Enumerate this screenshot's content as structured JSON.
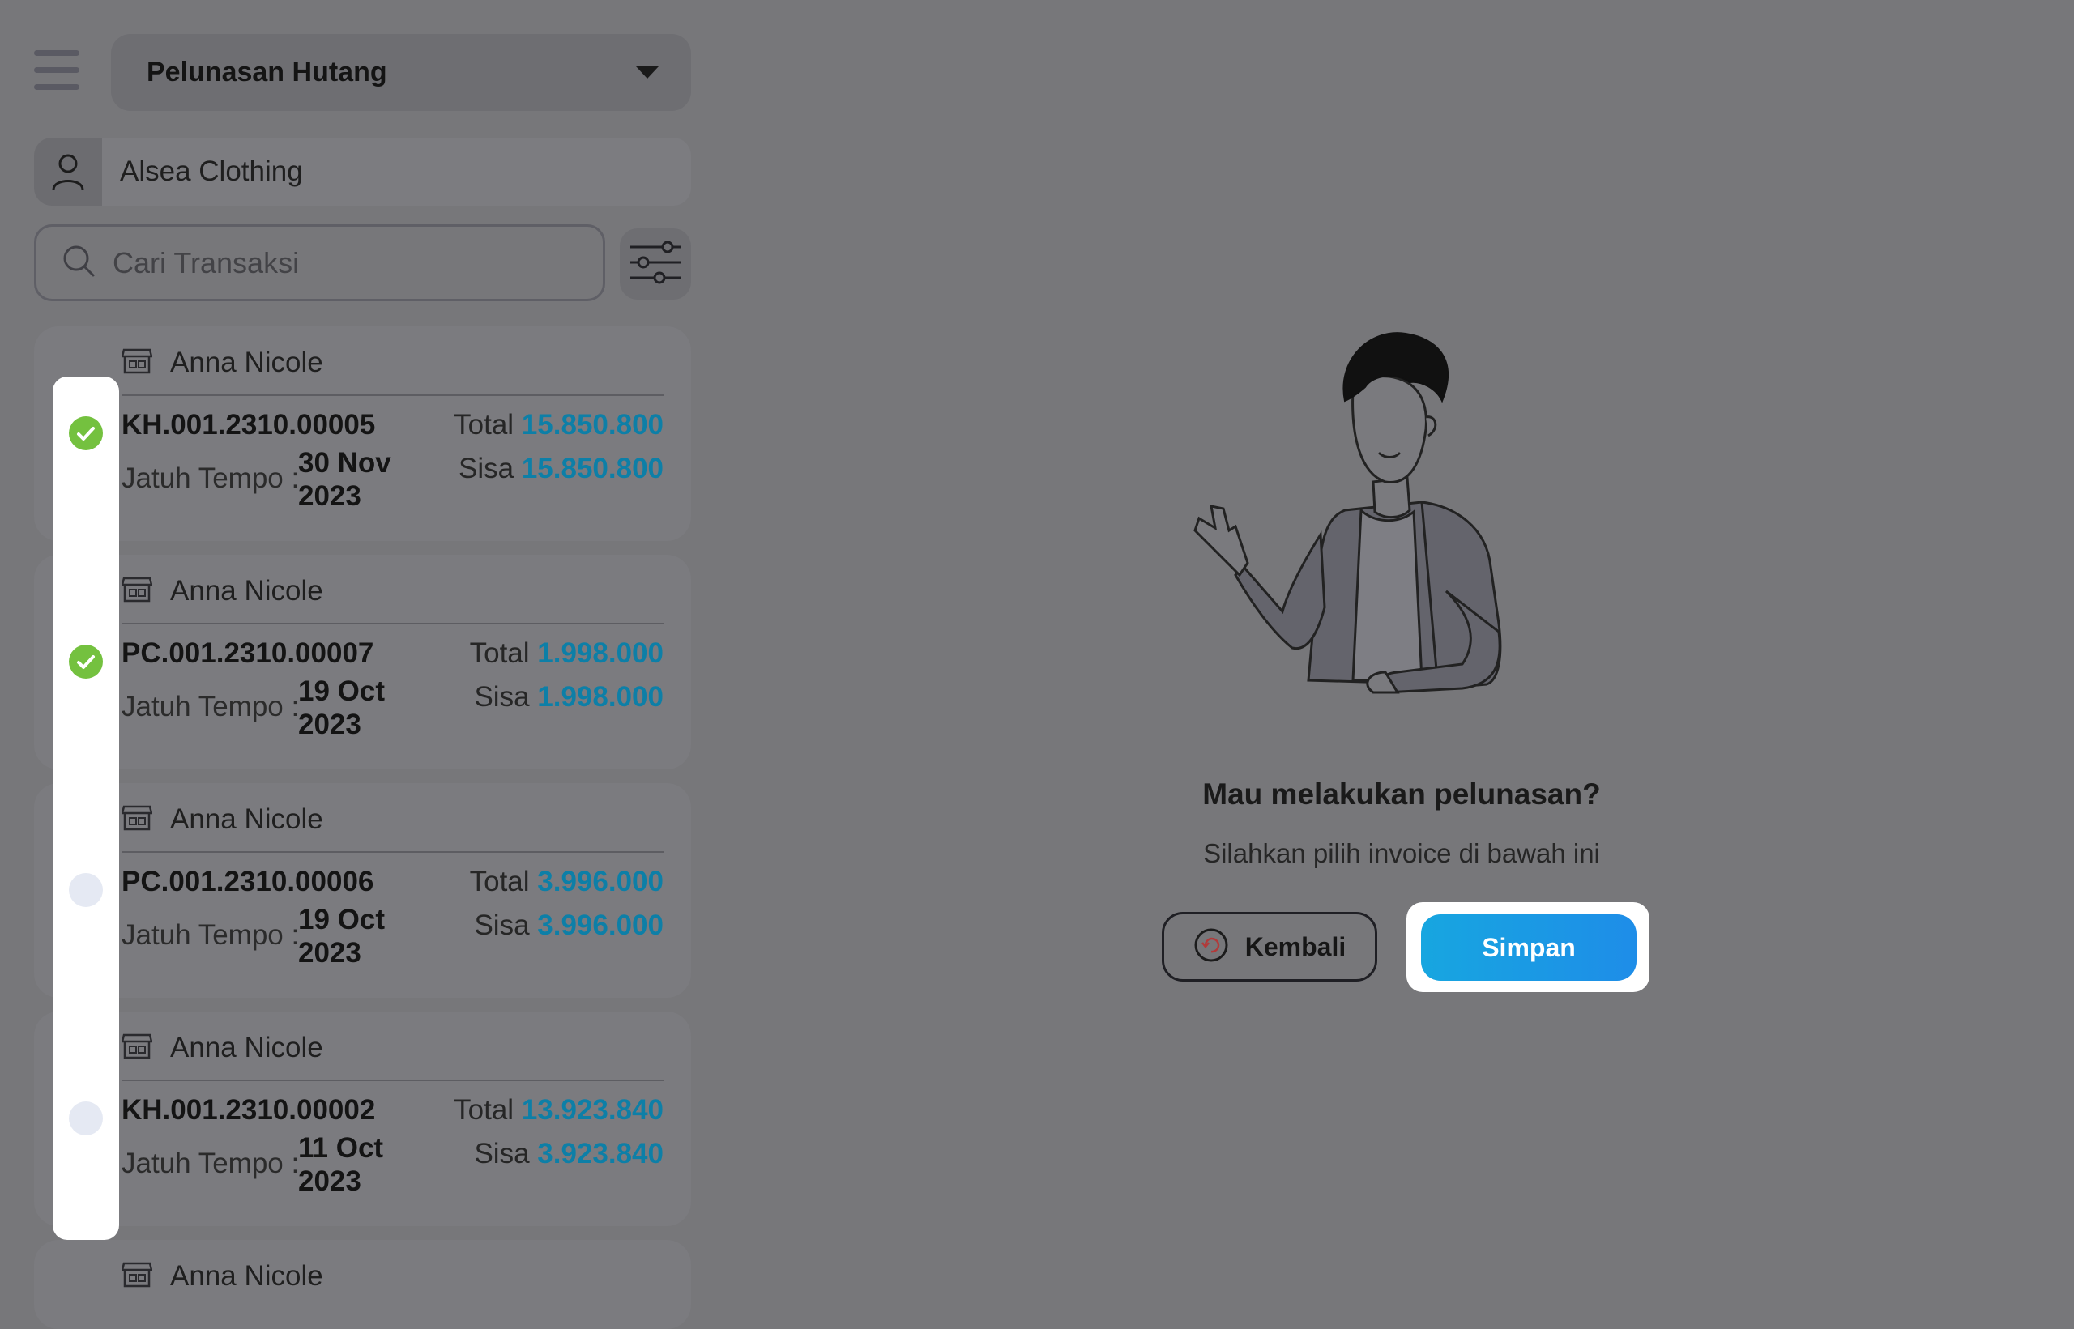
{
  "header": {
    "document_type": "Pelunasan Hutang"
  },
  "customer": {
    "name": "Alsea Clothing"
  },
  "search": {
    "placeholder": "Cari Transaksi"
  },
  "labels": {
    "due": "Jatuh Tempo :",
    "total": "Total",
    "remaining": "Sisa"
  },
  "invoices": [
    {
      "store": "Anna Nicole",
      "number": "KH.001.2310.00005",
      "due_date": "30 Nov 2023",
      "total": "15.850.800",
      "remaining": "15.850.800",
      "selected": true
    },
    {
      "store": "Anna Nicole",
      "number": "PC.001.2310.00007",
      "due_date": "19 Oct 2023",
      "total": "1.998.000",
      "remaining": "1.998.000",
      "selected": true
    },
    {
      "store": "Anna Nicole",
      "number": "PC.001.2310.00006",
      "due_date": "19 Oct 2023",
      "total": "3.996.000",
      "remaining": "3.996.000",
      "selected": false
    },
    {
      "store": "Anna Nicole",
      "number": "KH.001.2310.00002",
      "due_date": "11 Oct 2023",
      "total": "13.923.840",
      "remaining": "3.923.840",
      "selected": false
    },
    {
      "store": "Anna Nicole"
    }
  ],
  "empty_state": {
    "title": "Mau melakukan pelunasan?",
    "subtitle": "Silahkan pilih invoice di bawah ini"
  },
  "actions": {
    "back": "Kembali",
    "save": "Simpan"
  },
  "colors": {
    "accent": "#1e9be4",
    "amount": "#0d7fa7",
    "check_on": "#74c13f",
    "overlay": "#77777a"
  },
  "icons": {
    "menu": "hamburger-menu-icon",
    "dropdown": "chevron-down-icon",
    "customer": "user-icon",
    "search": "search-icon",
    "filter": "sliders-icon",
    "store": "store-icon",
    "check": "check-circle-icon",
    "back": "undo-icon"
  }
}
